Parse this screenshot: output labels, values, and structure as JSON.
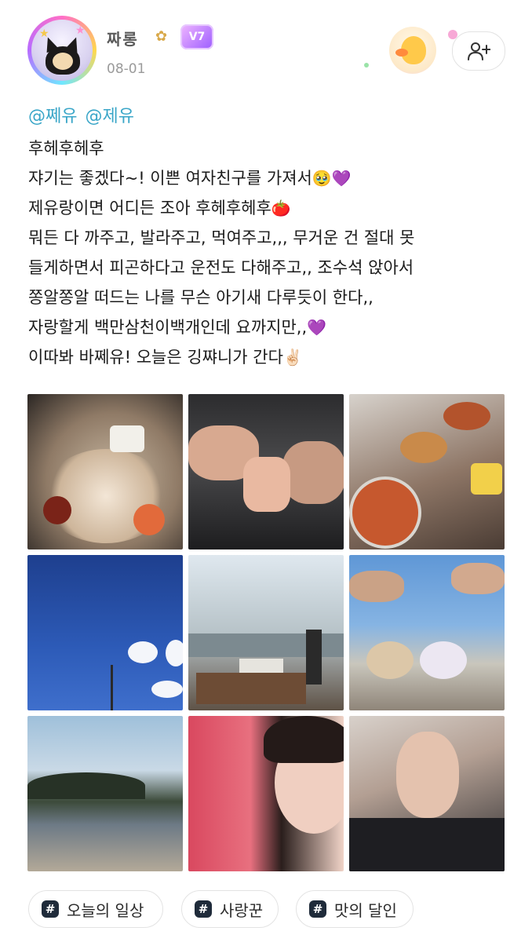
{
  "header": {
    "username": "짜롱",
    "flower": "✿",
    "vip_badge": "V7",
    "date": "08-01"
  },
  "post": {
    "mentions": [
      "@쩨유",
      "@제유"
    ],
    "lines": [
      "후헤후헤후",
      "쟈기는 좋겠다~! 이쁜 여자친구를 가져서",
      "제유랑이면 어디든 조아 후헤후헤후",
      "뭐든 다 까주고, 발라주고, 먹여주고,,, 무거운 건 절대 못",
      "들게하면서 피곤하다고 운전도 다해주고,, 조수석 앉아서",
      "쫑알쫑알 떠드는 나를 무슨 아기새 다루듯이 한다,,",
      "자랑할게 백만삼천이백개인데 요까지만,,",
      "이따봐 바쩨유! 오늘은 깅쨔니가 간다"
    ],
    "emojis": {
      "line2": "🥹💜",
      "line3": "🍅",
      "line7": "💜",
      "line8": "✌🏻"
    }
  },
  "photos": [
    {
      "subject": "seafood-platter-photo"
    },
    {
      "subject": "crab-leg-photo"
    },
    {
      "subject": "noodle-soup-photo"
    },
    {
      "subject": "blue-sky-photo"
    },
    {
      "subject": "seaside-cafe-photo"
    },
    {
      "subject": "plush-keychain-photo"
    },
    {
      "subject": "beach-island-photo"
    },
    {
      "subject": "selfie-photo"
    },
    {
      "subject": "holding-hands-photo"
    }
  ],
  "tags": [
    {
      "icon": "#",
      "label": "오늘의 일상"
    },
    {
      "icon": "#",
      "label": "사랑꾼"
    },
    {
      "icon": "#",
      "label": "맛의 달인"
    }
  ],
  "colors": {
    "mention": "#3aa6c8",
    "date": "#9a9a9a",
    "vip_badge": "#9b5cff",
    "tag_icon_bg": "#1f2b3a"
  },
  "icons": {
    "follow": "add-user-icon"
  }
}
